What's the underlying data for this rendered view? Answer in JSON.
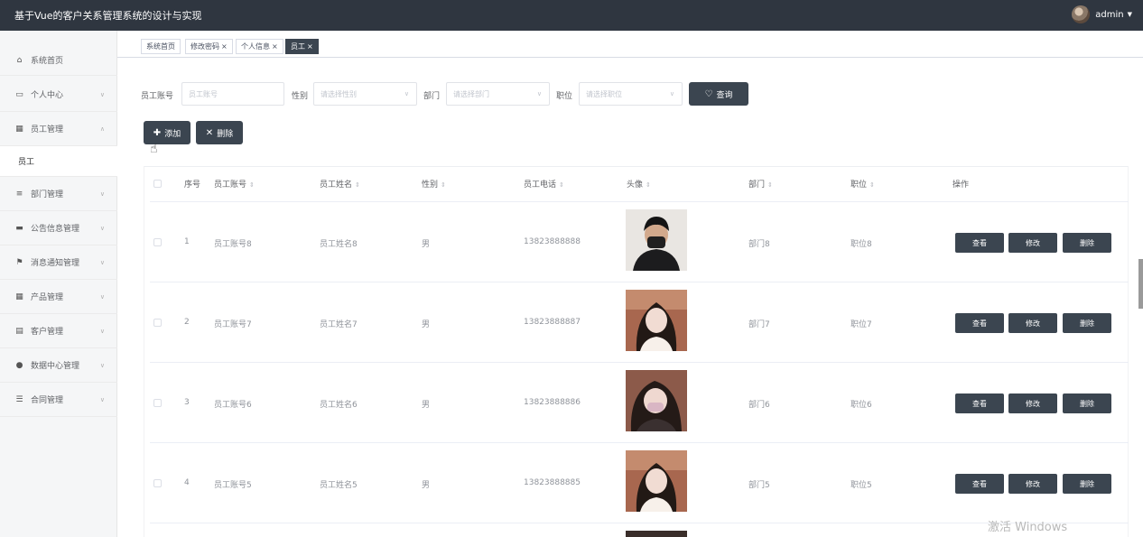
{
  "header": {
    "app_title": "基于Vue的客户关系管理系统的设计与实现",
    "username": "admin"
  },
  "sidebar": {
    "home": "系统首页",
    "items": [
      {
        "label": "个人中心",
        "icon": "monitor-icon",
        "glyph": "▭"
      },
      {
        "label": "员工管理",
        "icon": "grid-icon",
        "glyph": "▦"
      },
      {
        "label": "部门管理",
        "icon": "list-icon",
        "glyph": "≡"
      },
      {
        "label": "公告信息管理",
        "icon": "briefcase-icon",
        "glyph": "▬"
      },
      {
        "label": "消息通知管理",
        "icon": "flag-icon",
        "glyph": "⚑"
      },
      {
        "label": "产品管理",
        "icon": "grid-icon",
        "glyph": "▦"
      },
      {
        "label": "客户管理",
        "icon": "table-icon",
        "glyph": "▤"
      },
      {
        "label": "数据中心管理",
        "icon": "user-icon",
        "glyph": "●"
      },
      {
        "label": "合同管理",
        "icon": "sliders-icon",
        "glyph": "☰"
      }
    ],
    "submenu_active": "员工"
  },
  "tabs": [
    {
      "label": "系统首页",
      "closable": false
    },
    {
      "label": "修改密码",
      "closable": true
    },
    {
      "label": "个人信息",
      "closable": true
    },
    {
      "label": "员工",
      "closable": true,
      "active": true
    }
  ],
  "filters": {
    "account_label": "员工账号",
    "account_placeholder": "员工账号",
    "gender_label": "性别",
    "gender_placeholder": "请选择性别",
    "dept_label": "部门",
    "dept_placeholder": "请选择部门",
    "position_label": "职位",
    "position_placeholder": "请选择职位",
    "query_button": "查询"
  },
  "actions": {
    "add": "添加",
    "delete": "删除"
  },
  "table": {
    "headers": {
      "index": "序号",
      "account": "员工账号",
      "name": "员工姓名",
      "gender": "性别",
      "phone": "员工电话",
      "avatar": "头像",
      "dept": "部门",
      "position": "职位",
      "ops": "操作"
    },
    "rows": [
      {
        "index": "1",
        "account": "员工账号8",
        "name": "员工姓名8",
        "gender": "男",
        "phone": "13823888888",
        "dept": "部门8",
        "position": "职位8"
      },
      {
        "index": "2",
        "account": "员工账号7",
        "name": "员工姓名7",
        "gender": "男",
        "phone": "13823888887",
        "dept": "部门7",
        "position": "职位7"
      },
      {
        "index": "3",
        "account": "员工账号6",
        "name": "员工姓名6",
        "gender": "男",
        "phone": "13823888886",
        "dept": "部门6",
        "position": "职位6"
      },
      {
        "index": "4",
        "account": "员工账号5",
        "name": "员工姓名5",
        "gender": "男",
        "phone": "13823888885",
        "dept": "部门5",
        "position": "职位5"
      }
    ],
    "op_labels": {
      "view": "查看",
      "edit": "修改",
      "delete": "删除"
    }
  },
  "watermark": "激活 Windows"
}
